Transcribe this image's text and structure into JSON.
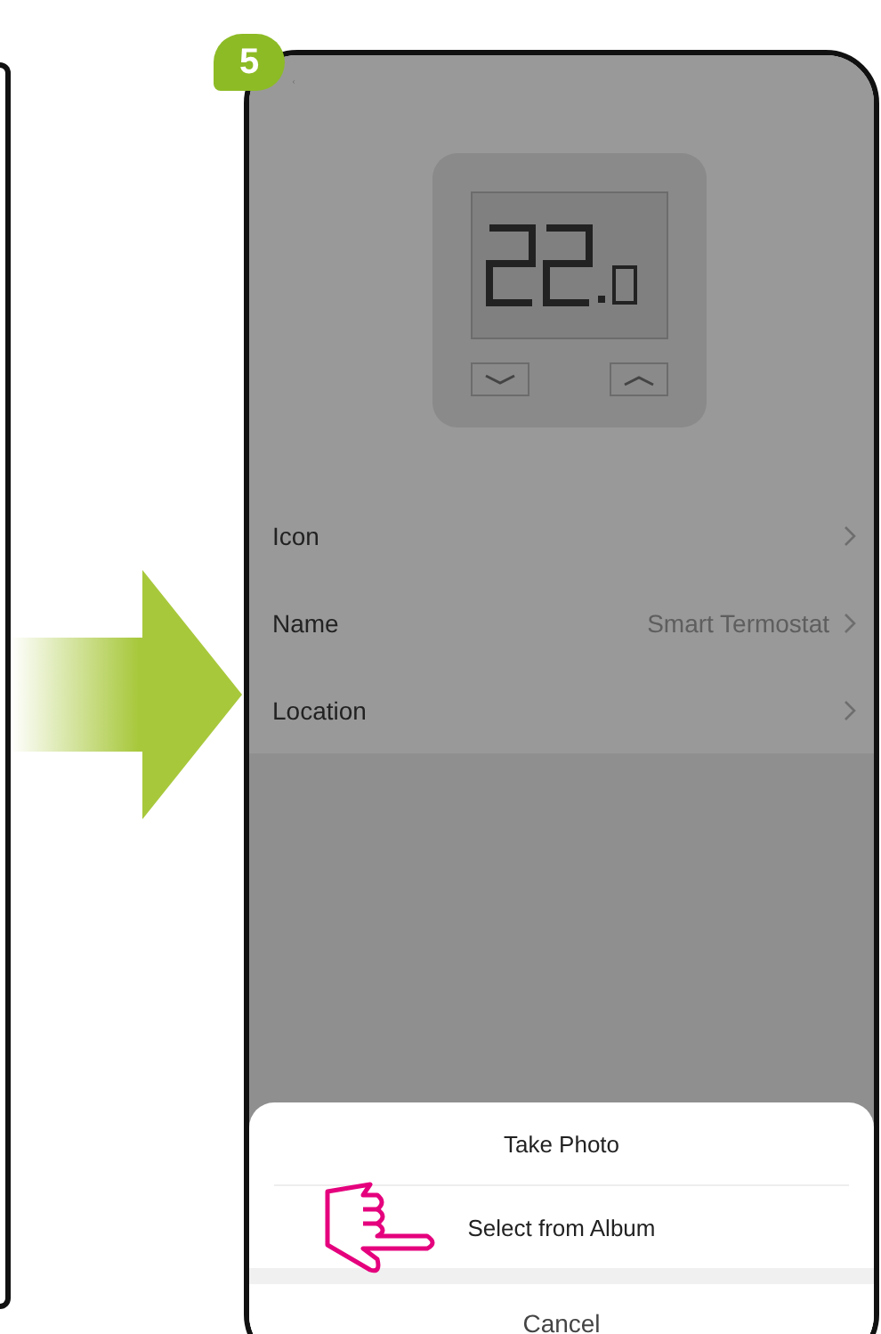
{
  "step": "5",
  "settings": [
    {
      "label": "Icon"
    },
    {
      "label": "Name",
      "value": "Smart Termostat"
    },
    {
      "label": "Location"
    }
  ],
  "action_sheet": {
    "options": [
      {
        "label": "Take Photo",
        "pointed": false
      },
      {
        "label": "Select from Album",
        "pointed": true
      }
    ],
    "cancel": "Cancel"
  }
}
